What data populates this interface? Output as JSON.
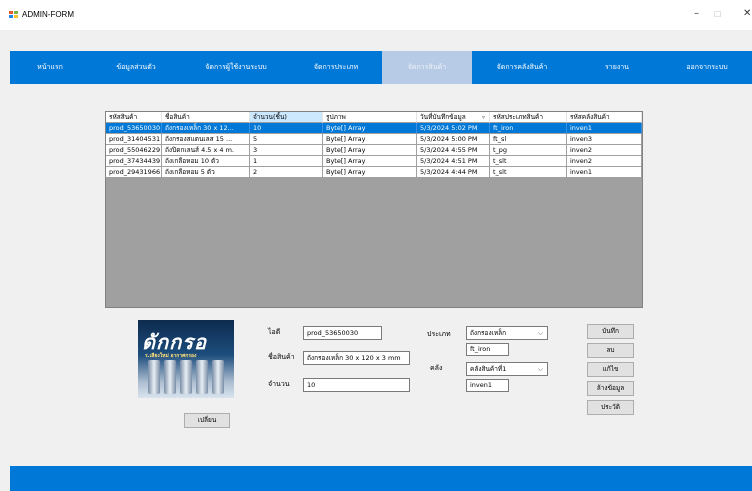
{
  "window": {
    "title": "ADMIN-FORM",
    "minimize": "–",
    "maximize": "☐",
    "close": "✕"
  },
  "nav": {
    "items": [
      "หน้าแรก",
      "ข้อมูลส่วนตัว",
      "จัดการผู้ใช้งานระบบ",
      "จัดการประเภท",
      "จัดการสินค้า",
      "จัดการคลังสินค้า",
      "รายงาน",
      "ออกจากระบบ"
    ],
    "active_index": 4
  },
  "table": {
    "headers": [
      "รหัสสินค้า",
      "ชื่อสินค้า",
      "จำนวน(ชิ้น)",
      "รูปภาพ",
      "วันที่บันทึกข้อมูล",
      "รหัสประเภทสินค้า",
      "รหัสคลังสินค้า"
    ],
    "sort_arrow": "▿",
    "rows": [
      [
        "prod_53650030",
        "ถังกรองเหล็ก 30 x 12...",
        "10",
        "Byte[] Array",
        "5/3/2024 5:02 PM",
        "ft_iron",
        "inven1"
      ],
      [
        "prod_31404531",
        "ถังกรองสแตนเลส 15 ...",
        "5",
        "Byte[] Array",
        "5/3/2024 5:00 PM",
        "ft_sl",
        "inven3"
      ],
      [
        "prod_55046229",
        "ถังปิดกเลนส์ 4.5 x 4 m.",
        "3",
        "Byte[] Array",
        "5/3/2024 4:55 PM",
        "t_pg",
        "inven2"
      ],
      [
        "prod_37434439",
        "ถังเกลือหอม 10 ตัว",
        "1",
        "Byte[] Array",
        "5/3/2024 4:51 PM",
        "t_slt",
        "inven2"
      ],
      [
        "prod_29431966",
        "ถังเกลือหอม 5 ตัว",
        "2",
        "Byte[] Array",
        "5/3/2024 4:44 PM",
        "t_slt",
        "inven1"
      ]
    ],
    "selected_row": 0
  },
  "image": {
    "title_text": "ดักกรอ",
    "sub_text": "ร.เสียงใหม่ อากาศกรอง",
    "change_button": "เปลี่ยน"
  },
  "form": {
    "id_label": "ไอดี",
    "id_value": "prod_53650030",
    "name_label": "ชื่อสินค้า",
    "name_value": "ถังกรองเหล็ก 30 x 120 x 3 mm",
    "qty_label": "จำนวน",
    "qty_value": "10",
    "type_label": "ประเภท",
    "type_select": "ถังกรองเหล็ก",
    "type_code": "ft_iron",
    "store_label": "คลัง",
    "store_select": "คลังสินค้าที่1",
    "store_code": "inven1"
  },
  "actions": {
    "save": "บันทึก",
    "delete": "ลบ",
    "edit": "แก้ไข",
    "clear": "ล้างข้อมูล",
    "history": "ประวัติ"
  }
}
